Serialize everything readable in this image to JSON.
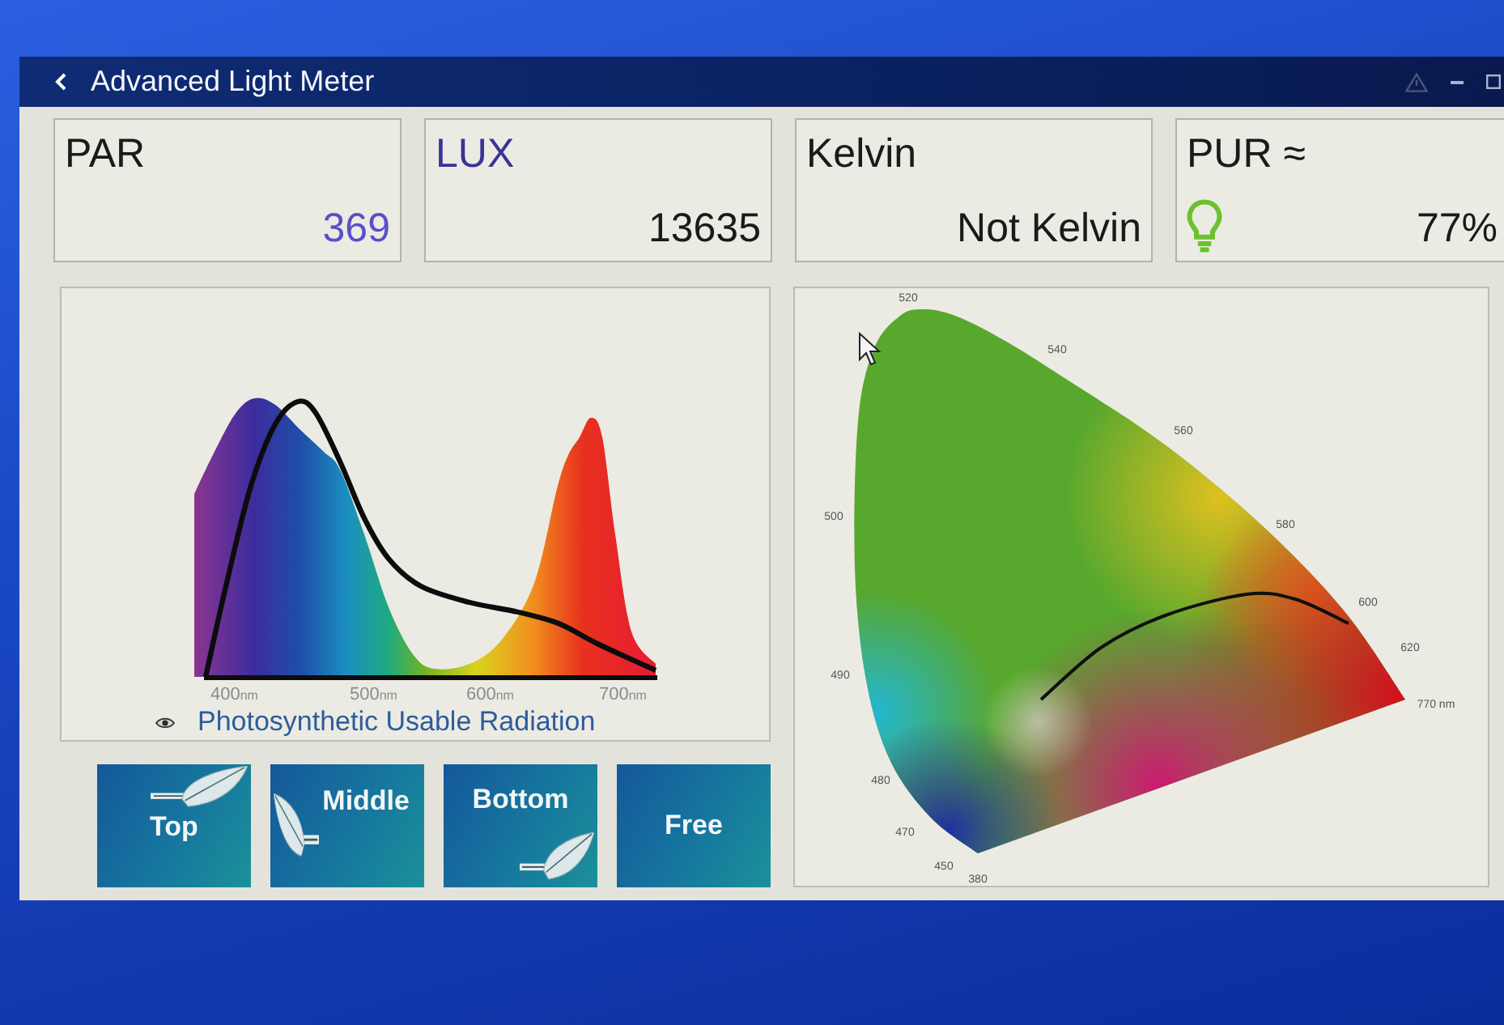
{
  "window": {
    "title": "Advanced Light Meter"
  },
  "readings": [
    {
      "label": "PAR",
      "value": "369",
      "label_highlighted": false,
      "value_highlighted": true,
      "kind": "plain"
    },
    {
      "label": "LUX",
      "value": "13635",
      "label_highlighted": true,
      "value_highlighted": false,
      "kind": "plain"
    },
    {
      "label": "Kelvin",
      "value": "Not Kelvin",
      "label_highlighted": false,
      "value_highlighted": false,
      "kind": "plain"
    },
    {
      "label": "PUR ≈",
      "value": "77%",
      "label_highlighted": false,
      "value_highlighted": false,
      "kind": "bulb"
    }
  ],
  "spectrum": {
    "ticks": [
      {
        "number": "400",
        "unit": "nm"
      },
      {
        "number": "500",
        "unit": "nm"
      },
      {
        "number": "600",
        "unit": "nm"
      },
      {
        "number": "700",
        "unit": "nm"
      }
    ],
    "legend": "Photosynthetic Usable Radiation"
  },
  "chromaticity": {
    "wavelength_labels": [
      "520",
      "540",
      "560",
      "580",
      "600",
      "620",
      "770 nm",
      "500",
      "490",
      "480",
      "470",
      "450",
      "380"
    ]
  },
  "modes": [
    {
      "label": "Top",
      "kind": "top"
    },
    {
      "label": "Middle",
      "kind": "middle"
    },
    {
      "label": "Bottom",
      "kind": "bottom"
    },
    {
      "label": "Free",
      "kind": "free"
    }
  ]
}
